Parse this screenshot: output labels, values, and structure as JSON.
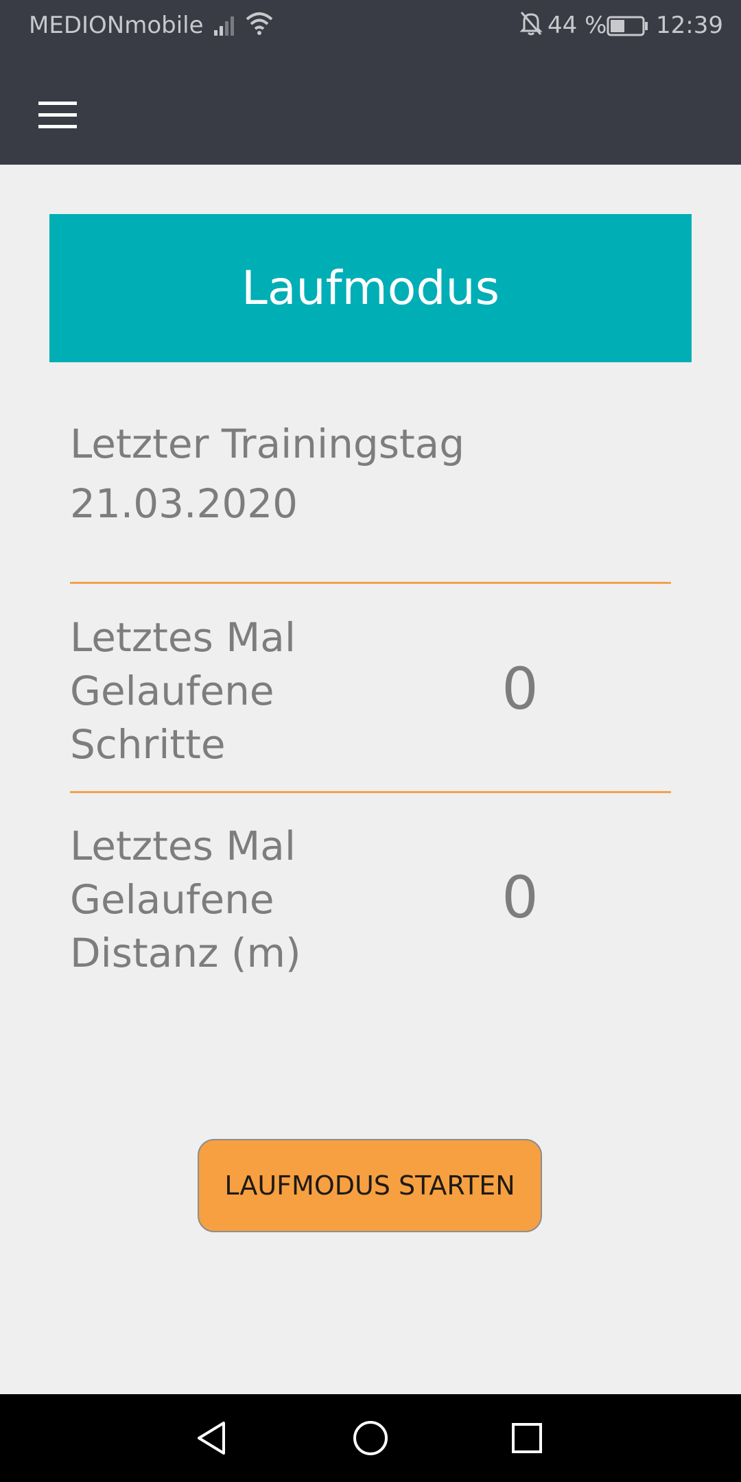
{
  "status_bar": {
    "carrier": "MEDIONmobile",
    "battery_percent": "44 %",
    "time": "12:39",
    "icons": [
      "signal-icon",
      "wifi-icon",
      "bell-off-icon",
      "battery-icon"
    ]
  },
  "app_bar": {
    "menu_icon": "menu-icon"
  },
  "main": {
    "title": "Laufmodus",
    "last_training": {
      "label": "Letzter Trainingstag",
      "date": "21.03.2020"
    },
    "steps": {
      "label_lines": [
        "Letztes Mal",
        "Gelaufene",
        "Schritte"
      ],
      "value": "0"
    },
    "distance": {
      "label_lines": [
        "Letztes Mal",
        "Gelaufene",
        "Distanz (m)"
      ],
      "value": "0"
    },
    "start_button_label": "LAUFMODUS STARTEN"
  },
  "nav_bar": {
    "icons": [
      "back-icon",
      "home-icon",
      "recents-icon"
    ]
  },
  "colors": {
    "header": "#393c45",
    "title_card": "#00aeb6",
    "divider": "#f4a04d",
    "button": "#f6a042",
    "text_gray": "#7d7d7d",
    "background": "#efefef"
  }
}
